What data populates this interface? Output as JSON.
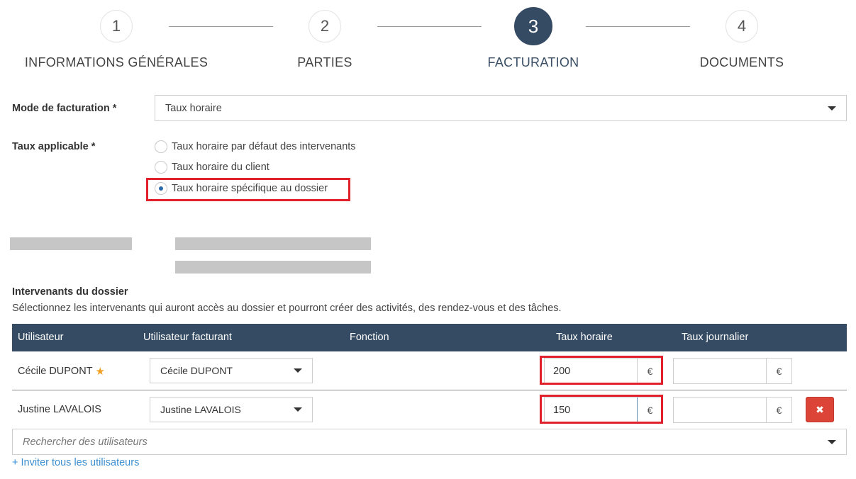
{
  "stepper": {
    "steps": [
      {
        "number": "1",
        "label": "INFORMATIONS GÉNÉRALES"
      },
      {
        "number": "2",
        "label": "PARTIES"
      },
      {
        "number": "3",
        "label": "FACTURATION"
      },
      {
        "number": "4",
        "label": "DOCUMENTS"
      }
    ],
    "active_step": "3"
  },
  "billing_mode": {
    "label": "Mode de facturation *",
    "value": "Taux horaire"
  },
  "applicable_rate": {
    "label": "Taux applicable *",
    "options": [
      {
        "label": "Taux horaire par défaut des intervenants",
        "checked": false
      },
      {
        "label": "Taux horaire du client",
        "checked": false
      },
      {
        "label": "Taux horaire spécifique au dossier",
        "checked": true
      }
    ]
  },
  "participants": {
    "title": "Intervenants du dossier",
    "description": "Sélectionnez les intervenants qui auront accès au dossier et pourront créer des activités, des rendez-vous et des tâches.",
    "columns": [
      "Utilisateur",
      "Utilisateur facturant",
      "Fonction",
      "Taux horaire",
      "Taux journalier"
    ],
    "rows": [
      {
        "user": "Cécile DUPONT",
        "billing_user": "Cécile DUPONT",
        "hourly_rate": "200",
        "daily_rate": "",
        "currency": "€",
        "is_owner": true
      },
      {
        "user": "Justine LAVALOIS",
        "billing_user": "Justine LAVALOIS",
        "hourly_rate": "150",
        "daily_rate": "",
        "currency": "€",
        "is_owner": false
      }
    ],
    "delete_label": "✖",
    "search_placeholder": "Rechercher des utilisateurs",
    "invite_label": "+ Inviter tous les utilisateurs"
  },
  "colors": {
    "primary": "#354b63",
    "highlight": "#e0202a",
    "danger": "#db4437",
    "link": "#3b8ed0",
    "star": "#f0a020"
  }
}
